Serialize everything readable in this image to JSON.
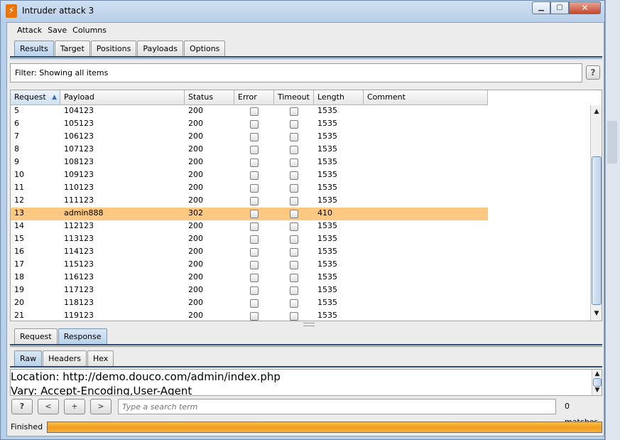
{
  "window": {
    "title": "Intruder attack 3",
    "icon": "burp-icon"
  },
  "menubar": {
    "items": [
      "Attack",
      "Save",
      "Columns"
    ]
  },
  "main_tabs": [
    {
      "label": "Results",
      "active": true
    },
    {
      "label": "Target",
      "active": false
    },
    {
      "label": "Positions",
      "active": false
    },
    {
      "label": "Payloads",
      "active": false
    },
    {
      "label": "Options",
      "active": false
    }
  ],
  "filter": {
    "text": "Filter:  Showing all items",
    "help": "?"
  },
  "table": {
    "columns": [
      "Request",
      "Payload",
      "Status",
      "Error",
      "Timeout",
      "Length",
      "Comment"
    ],
    "sorted_column": "Request",
    "rows": [
      {
        "request": "5",
        "payload": "104123",
        "status": "200",
        "length": "1535"
      },
      {
        "request": "6",
        "payload": "105123",
        "status": "200",
        "length": "1535"
      },
      {
        "request": "7",
        "payload": "106123",
        "status": "200",
        "length": "1535"
      },
      {
        "request": "8",
        "payload": "107123",
        "status": "200",
        "length": "1535"
      },
      {
        "request": "9",
        "payload": "108123",
        "status": "200",
        "length": "1535"
      },
      {
        "request": "10",
        "payload": "109123",
        "status": "200",
        "length": "1535"
      },
      {
        "request": "11",
        "payload": "110123",
        "status": "200",
        "length": "1535"
      },
      {
        "request": "12",
        "payload": "111123",
        "status": "200",
        "length": "1535"
      },
      {
        "request": "13",
        "payload": "admin888",
        "status": "302",
        "length": "410",
        "selected": true
      },
      {
        "request": "14",
        "payload": "112123",
        "status": "200",
        "length": "1535"
      },
      {
        "request": "15",
        "payload": "113123",
        "status": "200",
        "length": "1535"
      },
      {
        "request": "16",
        "payload": "114123",
        "status": "200",
        "length": "1535"
      },
      {
        "request": "17",
        "payload": "115123",
        "status": "200",
        "length": "1535"
      },
      {
        "request": "18",
        "payload": "116123",
        "status": "200",
        "length": "1535"
      },
      {
        "request": "19",
        "payload": "117123",
        "status": "200",
        "length": "1535"
      },
      {
        "request": "20",
        "payload": "118123",
        "status": "200",
        "length": "1535"
      },
      {
        "request": "21",
        "payload": "119123",
        "status": "200",
        "length": "1535"
      }
    ]
  },
  "detail_tabs": [
    {
      "label": "Request",
      "active": false
    },
    {
      "label": "Response",
      "active": true
    }
  ],
  "view_tabs": [
    {
      "label": "Raw",
      "active": true
    },
    {
      "label": "Headers",
      "active": false
    },
    {
      "label": "Hex",
      "active": false
    }
  ],
  "response_lines": [
    "Location: http://demo.douco.com/admin/index.php",
    "Vary: Accept-Encoding,User-Agent"
  ],
  "searchbar": {
    "help": "?",
    "prev": "<",
    "add": "+",
    "next": ">",
    "placeholder": "Type a search term",
    "matches": "0 matches"
  },
  "status": {
    "text": "Finished",
    "progress": 1.0
  },
  "colors": {
    "selected_row": "#fdc882",
    "progress": "#f29d1e"
  }
}
